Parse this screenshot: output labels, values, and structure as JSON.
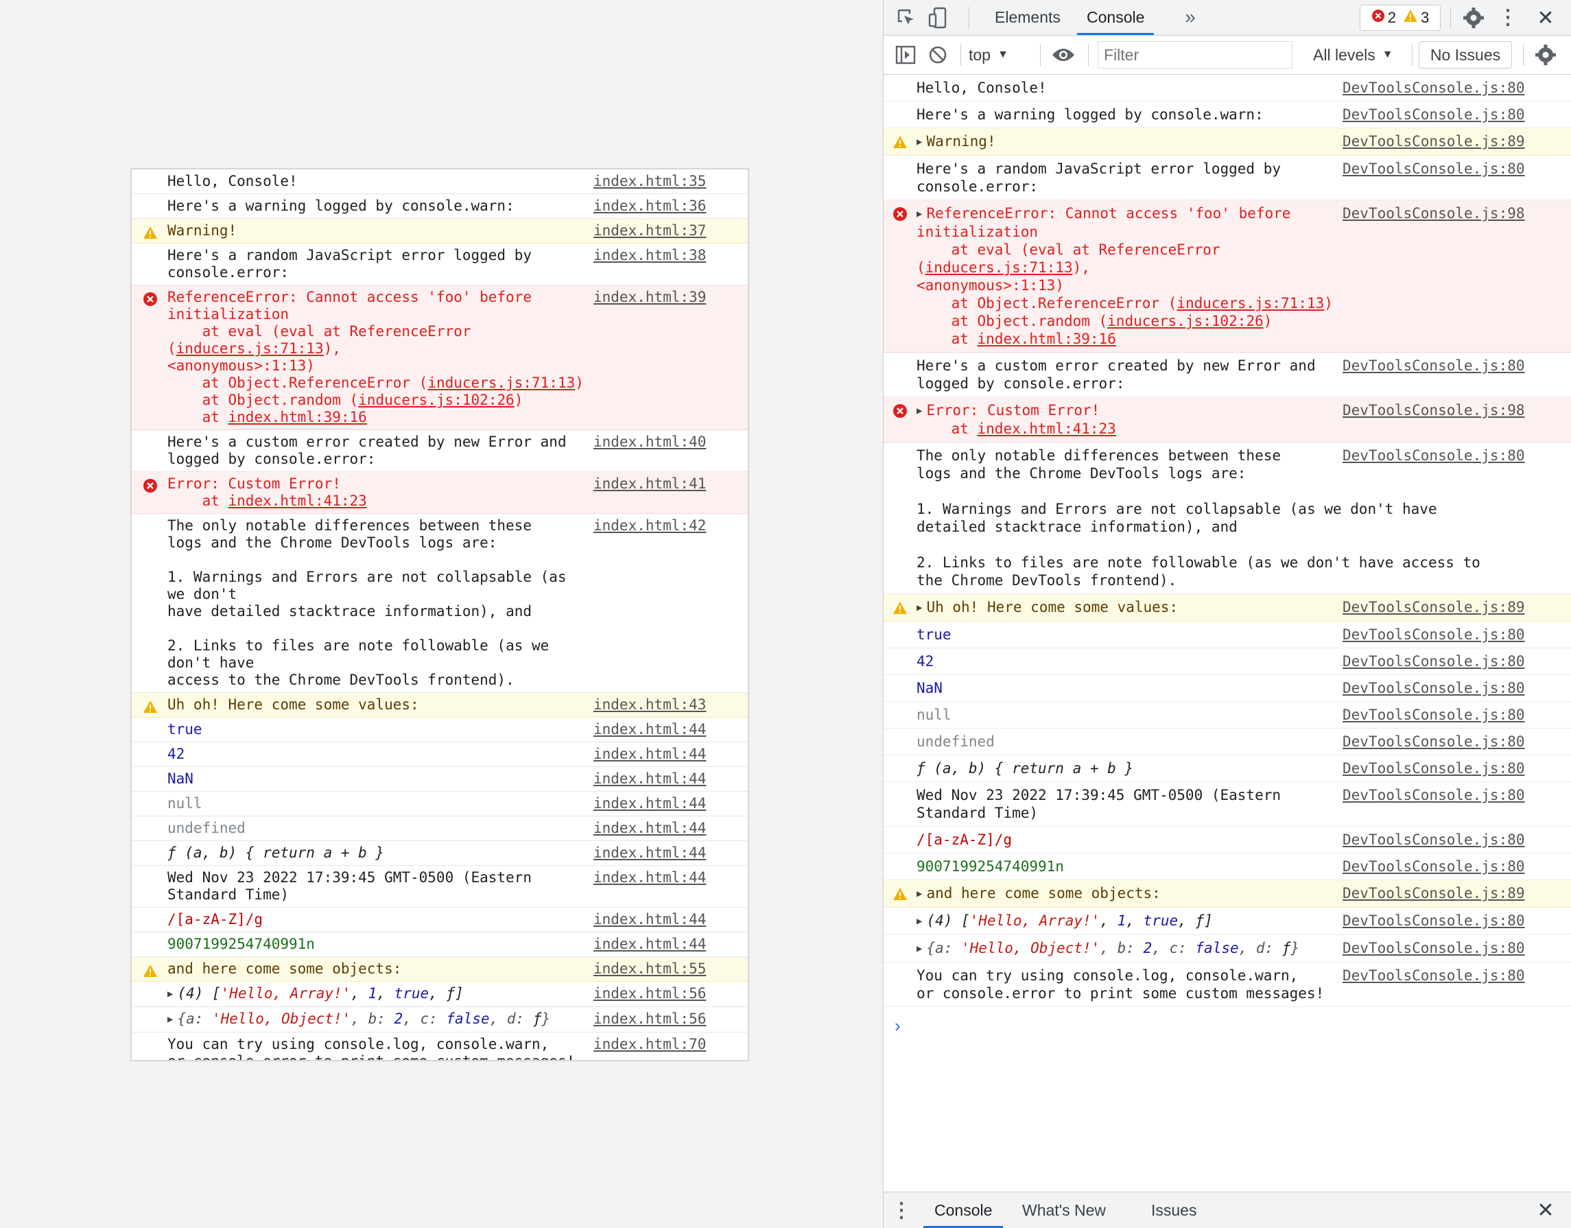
{
  "page": {
    "messages": [
      {
        "type": "log",
        "text": "Hello, Console!",
        "source": "index.html:35"
      },
      {
        "type": "log",
        "text": "Here's a warning logged by console.warn:",
        "source": "index.html:36"
      },
      {
        "type": "warn",
        "text": "Warning!",
        "source": "index.html:37"
      },
      {
        "type": "log",
        "text": "Here's a random JavaScript error logged by\nconsole.error:",
        "source": "index.html:38"
      },
      {
        "type": "error",
        "text": "ReferenceError: Cannot access 'foo' before\ninitialization",
        "source": "index.html:39",
        "stack": [
          {
            "pre": "    at eval (eval at ReferenceError (",
            "link": "inducers.js:71:13",
            "post": "),\n<anonymous>:1:13)"
          },
          {
            "pre": "    at Object.ReferenceError (",
            "link": "inducers.js:71:13",
            "post": ")"
          },
          {
            "pre": "    at Object.random (",
            "link": "inducers.js:102:26",
            "post": ")"
          },
          {
            "pre": "    at ",
            "link": "index.html:39:16",
            "post": ""
          }
        ]
      },
      {
        "type": "log",
        "text": "Here's a custom error created by new Error and\nlogged by console.error:",
        "source": "index.html:40"
      },
      {
        "type": "error",
        "text": "Error: Custom Error!",
        "source": "index.html:41",
        "stack": [
          {
            "pre": "    at ",
            "link": "index.html:41:23",
            "post": ""
          }
        ]
      },
      {
        "type": "log",
        "text": "The only notable differences between these\nlogs and the Chrome DevTools logs are:\n\n1. Warnings and Errors are not collapsable (as we don't\nhave detailed stacktrace information), and\n\n2. Links to files are note followable (as we don't have\naccess to the Chrome DevTools frontend).",
        "source": "index.html:42"
      },
      {
        "type": "warn",
        "text": "Uh oh! Here come some values:",
        "source": "index.html:43"
      },
      {
        "type": "value",
        "kind": "bool",
        "text": "true",
        "source": "index.html:44"
      },
      {
        "type": "value",
        "kind": "num",
        "text": "42",
        "source": "index.html:44"
      },
      {
        "type": "value",
        "kind": "num",
        "text": "NaN",
        "source": "index.html:44"
      },
      {
        "type": "value",
        "kind": "nullish",
        "text": "null",
        "source": "index.html:44"
      },
      {
        "type": "value",
        "kind": "nullish",
        "text": "undefined",
        "source": "index.html:44"
      },
      {
        "type": "value",
        "kind": "func",
        "text": "ƒ (a, b) { return a + b }",
        "source": "index.html:44"
      },
      {
        "type": "log",
        "text": "Wed Nov 23 2022 17:39:45 GMT-0500 (Eastern\nStandard Time)",
        "source": "index.html:44"
      },
      {
        "type": "value",
        "kind": "regex",
        "text": "/[a-zA-Z]/g",
        "source": "index.html:44"
      },
      {
        "type": "value",
        "kind": "bigint",
        "text": "9007199254740991n",
        "source": "index.html:44"
      },
      {
        "type": "warn",
        "text": "and here come some objects:",
        "source": "index.html:55"
      },
      {
        "type": "array",
        "source": "index.html:56"
      },
      {
        "type": "object",
        "source": "index.html:56"
      },
      {
        "type": "log",
        "text": "You can try using console.log, console.warn,\nor console.error to print some custom messages!",
        "source": "index.html:70"
      }
    ]
  },
  "objects": {
    "array": {
      "prefix": "(4) [",
      "s1": "'Hello, Array!'",
      "c1": ", ",
      "n1": "1",
      "c2": ", ",
      "b1": "true",
      "c3": ", ",
      "f1": "ƒ",
      "suffix": "]"
    },
    "object": {
      "prefix": "{a: ",
      "s1": "'Hello, Object!'",
      "c1": ", b: ",
      "n1": "2",
      "c2": ", c: ",
      "b1": "false",
      "c3": ", d: ",
      "f1": "ƒ",
      "suffix": "}"
    }
  },
  "devtools": {
    "tabs": [
      "Elements",
      "Console"
    ],
    "active_tab": "Console",
    "error_count": "2",
    "warning_count": "3",
    "context": "top",
    "filter_placeholder": "Filter",
    "levels": "All levels",
    "issues": "No Issues",
    "drawer_tabs": [
      "Console",
      "What's New",
      "Issues"
    ],
    "messages": [
      {
        "type": "log",
        "text": "Hello, Console!",
        "source": "DevToolsConsole.js:80"
      },
      {
        "type": "log",
        "text": "Here's a warning logged by console.warn:",
        "source": "DevToolsConsole.js:80"
      },
      {
        "type": "warn",
        "text": "Warning!",
        "source": "DevToolsConsole.js:89",
        "expandable": true
      },
      {
        "type": "log",
        "text": "Here's a random JavaScript error logged by\nconsole.error:",
        "source": "DevToolsConsole.js:80"
      },
      {
        "type": "error",
        "text": "ReferenceError: Cannot access 'foo' before\ninitialization",
        "source": "DevToolsConsole.js:98",
        "expandable": true,
        "stack": [
          {
            "pre": "    at eval (eval at ReferenceError (",
            "link": "inducers.js:71:13",
            "post": "),\n<anonymous>:1:13)"
          },
          {
            "pre": "    at Object.ReferenceError (",
            "link": "inducers.js:71:13",
            "post": ")"
          },
          {
            "pre": "    at Object.random (",
            "link": "inducers.js:102:26",
            "post": ")"
          },
          {
            "pre": "    at ",
            "link": "index.html:39:16",
            "post": ""
          }
        ]
      },
      {
        "type": "log",
        "text": "Here's a custom error created by new Error and\nlogged by console.error:",
        "source": "DevToolsConsole.js:80"
      },
      {
        "type": "error",
        "text": "Error: Custom Error!",
        "source": "DevToolsConsole.js:98",
        "expandable": true,
        "stack": [
          {
            "pre": "    at ",
            "link": "index.html:41:23",
            "post": ""
          }
        ]
      },
      {
        "type": "log",
        "text": "The only notable differences between these\nlogs and the Chrome DevTools logs are:",
        "tail": "\n1. Warnings and Errors are not collapsable (as we don't have\ndetailed stacktrace information), and\n\n2. Links to files are note followable (as we don't have access to\nthe Chrome DevTools frontend).",
        "source": "DevToolsConsole.js:80"
      },
      {
        "type": "warn",
        "text": "Uh oh! Here come some values:",
        "source": "DevToolsConsole.js:89",
        "expandable": true
      },
      {
        "type": "value",
        "kind": "bool",
        "text": "true",
        "source": "DevToolsConsole.js:80"
      },
      {
        "type": "value",
        "kind": "num",
        "text": "42",
        "source": "DevToolsConsole.js:80"
      },
      {
        "type": "value",
        "kind": "num",
        "text": "NaN",
        "source": "DevToolsConsole.js:80"
      },
      {
        "type": "value",
        "kind": "nullish",
        "text": "null",
        "source": "DevToolsConsole.js:80"
      },
      {
        "type": "value",
        "kind": "nullish",
        "text": "undefined",
        "source": "DevToolsConsole.js:80"
      },
      {
        "type": "value",
        "kind": "func",
        "text": "ƒ (a, b) { return a + b }",
        "source": "DevToolsConsole.js:80"
      },
      {
        "type": "log",
        "text": "Wed Nov 23 2022 17:39:45 GMT-0500 (Eastern\nStandard Time)",
        "source": "DevToolsConsole.js:80"
      },
      {
        "type": "value",
        "kind": "regex",
        "text": "/[a-zA-Z]/g",
        "source": "DevToolsConsole.js:80"
      },
      {
        "type": "value",
        "kind": "bigint",
        "text": "9007199254740991n",
        "source": "DevToolsConsole.js:80"
      },
      {
        "type": "warn",
        "text": "and here come some objects:",
        "source": "DevToolsConsole.js:89",
        "expandable": true
      },
      {
        "type": "array",
        "source": "DevToolsConsole.js:80"
      },
      {
        "type": "object",
        "source": "DevToolsConsole.js:80"
      },
      {
        "type": "log",
        "text": "You can try using console.log, console.warn,\nor console.error to print some custom messages!",
        "source": "DevToolsConsole.js:80"
      }
    ]
  },
  "colors": {
    "accent": "#1a73e8",
    "error": "#e01e1e",
    "warning": "#f2b000",
    "link": "#555555"
  }
}
